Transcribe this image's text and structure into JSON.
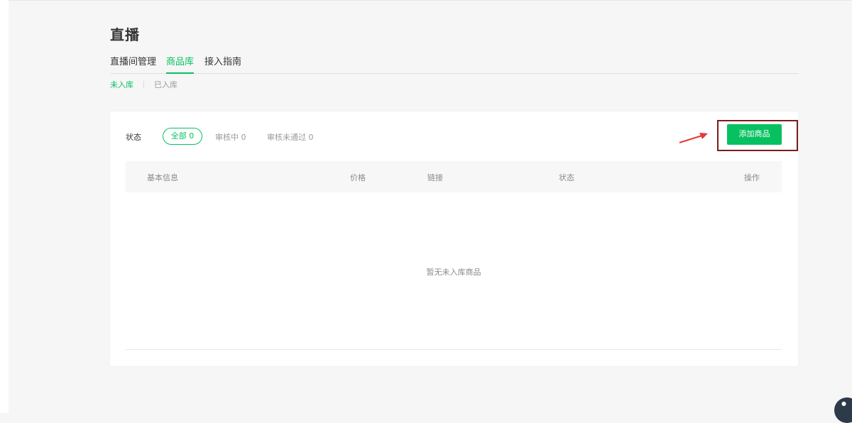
{
  "page": {
    "title": "直播"
  },
  "tabs": [
    {
      "label": "直播间管理",
      "active": false
    },
    {
      "label": "商品库",
      "active": true
    },
    {
      "label": "接入指南",
      "active": false
    }
  ],
  "subtabs": [
    {
      "label": "未入库",
      "active": true
    },
    {
      "label": "已入库",
      "active": false
    }
  ],
  "filter": {
    "label": "状态",
    "options": [
      {
        "label": "全部 0",
        "active": true
      },
      {
        "label": "审核中 0",
        "active": false
      },
      {
        "label": "审核未通过 0",
        "active": false
      }
    ]
  },
  "toolbar": {
    "add_label": "添加商品"
  },
  "table": {
    "columns": [
      "基本信息",
      "价格",
      "链接",
      "状态",
      "操作"
    ],
    "rows": [],
    "empty_text": "暂无未入库商品"
  },
  "colors": {
    "accent": "#07c160",
    "highlight_box": "#7a1c1c",
    "arrow": "#e53935"
  },
  "icons": {
    "annotation": "red-arrow-icon",
    "floating": "floating-action-icon"
  }
}
